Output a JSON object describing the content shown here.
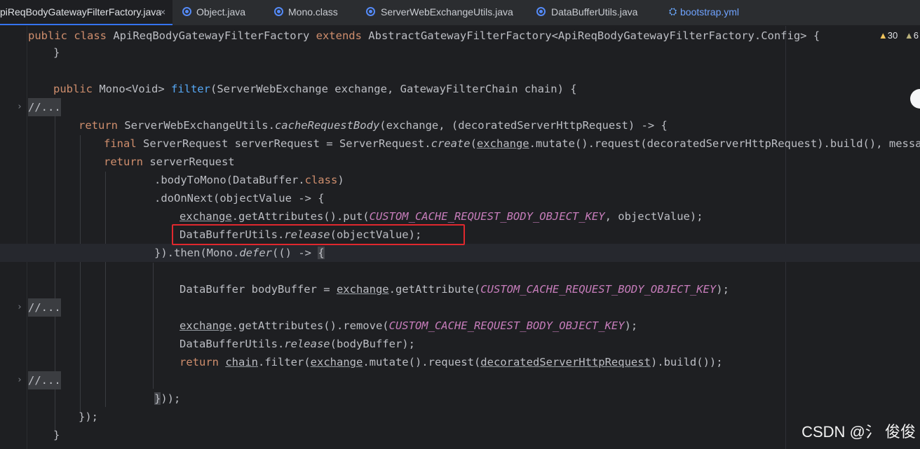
{
  "tabs": [
    {
      "label": "piReqBodyGatewayFilterFactory.java",
      "active": true,
      "close": "×"
    },
    {
      "label": "Object.java"
    },
    {
      "label": "Mono.class"
    },
    {
      "label": "ServerWebExchangeUtils.java"
    },
    {
      "label": "DataBufferUtils.java"
    },
    {
      "label": "bootstrap.yml"
    }
  ],
  "inspections": {
    "warnings": "30",
    "weak_warnings": "6"
  },
  "code": {
    "l0": {
      "kw1": "public class ",
      "name": "ApiReqBodyGatewayFilterFactory ",
      "kw2": "extends ",
      "rest": "AbstractGatewayFilterFactory<ApiReqBodyGatewayFilterFactory.Config> {"
    },
    "l1": "}",
    "l3": {
      "kw": "public ",
      "type": "Mono<Void> ",
      "fn": "filter",
      "rest": "(ServerWebExchange exchange, GatewayFilterChain chain) {"
    },
    "fold": "//...",
    "l5": {
      "kw": "return ",
      "a": "ServerWebExchangeUtils.",
      "m": "cacheRequestBody",
      "rest": "(exchange, (decoratedServerHttpRequest) -> {"
    },
    "l6": {
      "kw": "final ",
      "a": "ServerRequest serverRequest = ServerRequest.",
      "m": "create",
      "b": "(",
      "ex": "exchange",
      "rest": ".mutate().request(decoratedServerHttpRequest).build(), messageRea"
    },
    "l7": {
      "kw": "return ",
      "rest": "serverRequest"
    },
    "l8": {
      "a": ".bodyToMono(DataBuffer.",
      "kw": "class",
      "b": ")"
    },
    "l9": ".doOnNext(objectValue -> {",
    "l10": {
      "ex": "exchange",
      "a": ".getAttributes().put(",
      "c": "CUSTOM_CACHE_REQUEST_BODY_OBJECT_KEY",
      "b": ", objectValue);"
    },
    "l11": {
      "a": "DataBufferUtils.",
      "m": "release",
      "b": "(objectValue);"
    },
    "l12": {
      "a": "}).then(Mono.",
      "m": "defer",
      "b": "(() -> ",
      "brace": "{"
    },
    "l14": {
      "a": "DataBuffer bodyBuffer = ",
      "ex": "exchange",
      "b": ".getAttribute(",
      "c": "CUSTOM_CACHE_REQUEST_BODY_OBJECT_KEY",
      "d": ");"
    },
    "l16": {
      "ex": "exchange",
      "a": ".getAttributes().remove(",
      "c": "CUSTOM_CACHE_REQUEST_BODY_OBJECT_KEY",
      "b": ");"
    },
    "l17": {
      "a": "DataBufferUtils.",
      "m": "release",
      "b": "(bodyBuffer);"
    },
    "l18": {
      "kw": "return ",
      "ch": "chain",
      "a": ".filter(",
      "ex": "exchange",
      "b": ".mutate().request(",
      "dr": "decoratedServerHttpRequest",
      "c": ").build());"
    },
    "l20": {
      "brace": "}",
      "rest": "));"
    },
    "l21": "});",
    "l22": "}"
  },
  "colors": {
    "highlight_box": "#e0282e",
    "keyword": "#cf8e6d",
    "method": "#56a8f5",
    "constant": "#c77dbb"
  },
  "watermark": "CSDN @氵 俊俊"
}
